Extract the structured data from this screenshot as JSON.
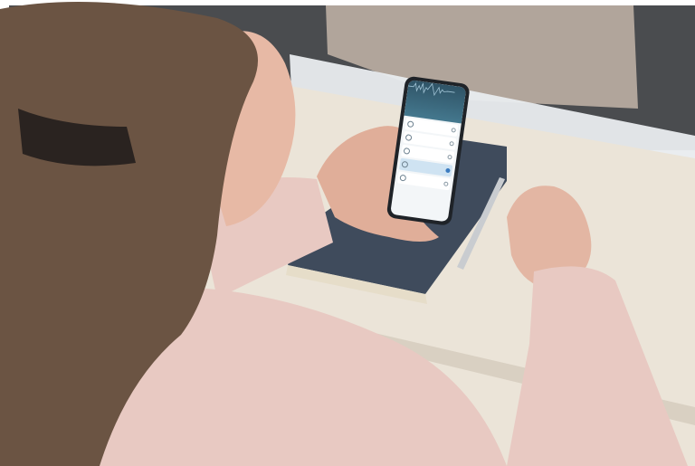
{
  "colors": {
    "background": "#ffffff",
    "wall": "#4a4c4f",
    "desk": "#ebe4d8",
    "book": "#3f4b5c",
    "sweater": "#e8c9c2",
    "hair": "#6b5443",
    "phone_header": "#2f5366",
    "accent": "#3b7bbf"
  },
  "phone_app": {
    "header_title": "",
    "programs": [
      {
        "label": "",
        "sublabel": "",
        "icon": "headphones-icon",
        "selected": false
      },
      {
        "label": "",
        "sublabel": "",
        "icon": "speaker-icon",
        "selected": false
      },
      {
        "label": "",
        "sublabel": "",
        "icon": "settings-icon",
        "selected": false
      },
      {
        "label": "",
        "sublabel": "",
        "icon": "hearing-icon",
        "selected": true
      },
      {
        "label": "",
        "sublabel": "",
        "icon": "headphones-icon",
        "selected": false
      }
    ],
    "footer_text": ""
  }
}
